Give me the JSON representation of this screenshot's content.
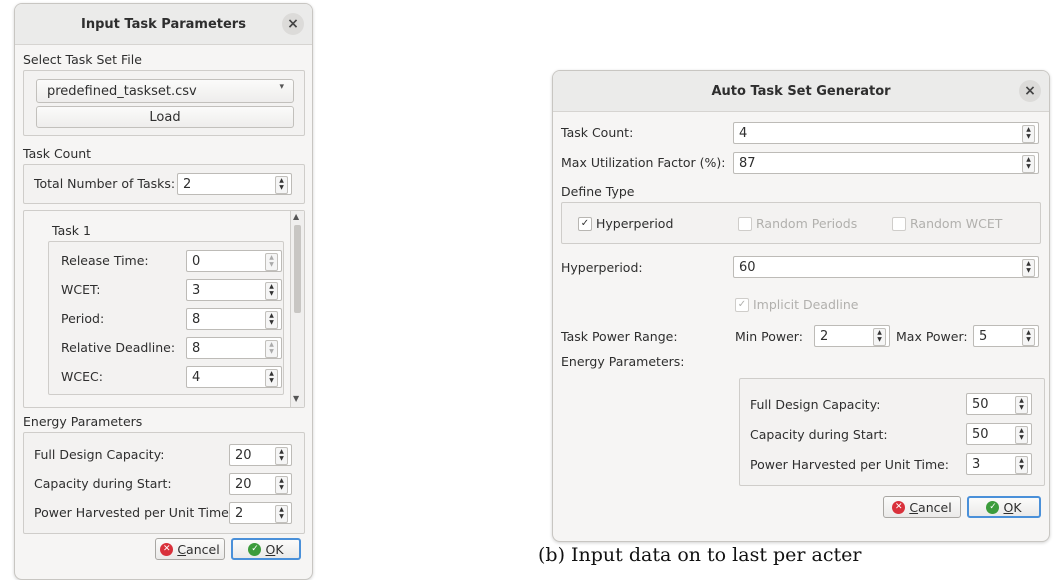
{
  "left": {
    "title": "Input Task Parameters",
    "close_glyph": "×",
    "select_section": "Select Task Set File",
    "file_value": "predefined_taskset.csv",
    "load_label": "Load",
    "task_count_section": "Task Count",
    "total_tasks_label": "Total Number of Tasks:",
    "total_tasks_value": "2",
    "task_header": "Task 1",
    "fields": [
      {
        "label": "Release Time:",
        "value": "0"
      },
      {
        "label": "WCET:",
        "value": "3"
      },
      {
        "label": "Period:",
        "value": "8"
      },
      {
        "label": "Relative Deadline:",
        "value": "8"
      },
      {
        "label": "WCEC:",
        "value": "4"
      }
    ],
    "energy_section": "Energy Parameters",
    "energy": [
      {
        "label": "Full Design Capacity:",
        "value": "20"
      },
      {
        "label": "Capacity during Start:",
        "value": "20"
      },
      {
        "label": "Power Harvested per Unit Time:",
        "value": "2"
      }
    ],
    "cancel_prefix": "",
    "cancel_key": "C",
    "cancel_rest": "ancel",
    "ok_key": "O",
    "ok_rest": "K"
  },
  "right": {
    "title": "Auto Task Set Generator",
    "close_glyph": "×",
    "task_count_label": "Task Count:",
    "task_count_value": "4",
    "max_util_label": "Max Utilization Factor (%):",
    "max_util_value": "87",
    "define_type_label": "Define Type",
    "hyperperiod_check": "Hyperperiod",
    "random_periods": "Random Periods",
    "random_wcet": "Random WCET",
    "hyperperiod_label": "Hyperperiod:",
    "hyperperiod_value": "60",
    "implicit_deadline": "Implicit Deadline",
    "power_range_label": "Task Power Range:",
    "min_power_label": "Min Power:",
    "min_power_value": "2",
    "max_power_label": "Max Power:",
    "max_power_value": "5",
    "energy_label": "Energy Parameters:",
    "energy": [
      {
        "label": "Full Design Capacity:",
        "value": "50"
      },
      {
        "label": "Capacity during Start:",
        "value": "50"
      },
      {
        "label": "Power Harvested per Unit Time:",
        "value": "3"
      }
    ],
    "cancel_key": "C",
    "cancel_rest": "ancel",
    "ok_key": "O",
    "ok_rest": "K"
  },
  "caption_fragment": "(b) Input data on to last per acter"
}
